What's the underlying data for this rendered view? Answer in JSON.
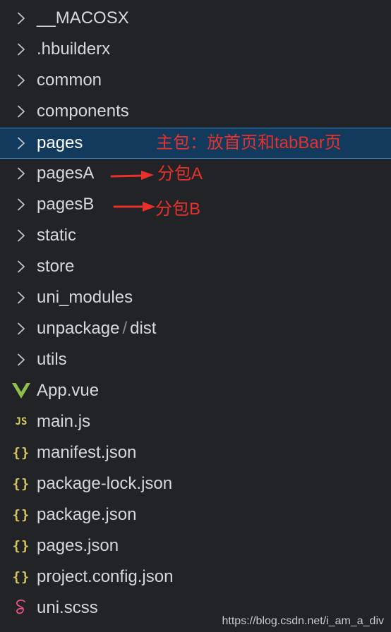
{
  "explorer": {
    "items": [
      {
        "kind": "folder",
        "icon": "chevron-right-icon",
        "label": "__MACOSX"
      },
      {
        "kind": "folder",
        "icon": "chevron-right-icon",
        "label": ".hbuilderx"
      },
      {
        "kind": "folder",
        "icon": "chevron-right-icon",
        "label": "common"
      },
      {
        "kind": "folder",
        "icon": "chevron-right-icon",
        "label": "components"
      },
      {
        "kind": "folder",
        "icon": "chevron-right-icon",
        "label": "pages",
        "selected": true
      },
      {
        "kind": "folder",
        "icon": "chevron-right-icon",
        "label": "pagesA"
      },
      {
        "kind": "folder",
        "icon": "chevron-right-icon",
        "label": "pagesB"
      },
      {
        "kind": "folder",
        "icon": "chevron-right-icon",
        "label": "static"
      },
      {
        "kind": "folder",
        "icon": "chevron-right-icon",
        "label": "store"
      },
      {
        "kind": "folder",
        "icon": "chevron-right-icon",
        "label": "uni_modules"
      },
      {
        "kind": "folder",
        "icon": "chevron-right-icon",
        "label": "unpackage",
        "sub": "dist"
      },
      {
        "kind": "folder",
        "icon": "chevron-right-icon",
        "label": "utils"
      },
      {
        "kind": "file",
        "icon": "vue-icon",
        "label": "App.vue"
      },
      {
        "kind": "file",
        "icon": "js-icon",
        "icon_text": "JS",
        "label": "main.js"
      },
      {
        "kind": "file",
        "icon": "json-icon",
        "icon_text": "{}",
        "label": "manifest.json"
      },
      {
        "kind": "file",
        "icon": "json-icon",
        "icon_text": "{}",
        "label": "package-lock.json"
      },
      {
        "kind": "file",
        "icon": "json-icon",
        "icon_text": "{}",
        "label": "package.json"
      },
      {
        "kind": "file",
        "icon": "json-icon",
        "icon_text": "{}",
        "label": "pages.json"
      },
      {
        "kind": "file",
        "icon": "json-icon",
        "icon_text": "{}",
        "label": "project.config.json"
      },
      {
        "kind": "file",
        "icon": "sass-icon",
        "label": "uni.scss"
      }
    ]
  },
  "annotations": {
    "main_package": "主包：放首页和tabBar页",
    "sub_package_a": "分包A",
    "sub_package_b": "分包B"
  },
  "watermark": "https://blog.csdn.net/i_am_a_div",
  "colors": {
    "background": "#222326",
    "selected_row": "#113a5c",
    "selected_border": "#3d86c9",
    "annotation_red": "#e8312b",
    "vue_green": "#8dc149",
    "json_yellow": "#d8c45c",
    "sass_pink": "#f55385"
  }
}
